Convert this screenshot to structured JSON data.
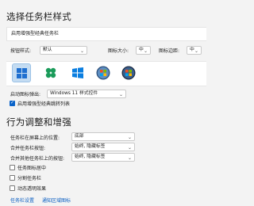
{
  "section1": {
    "title": "选择任务栏样式",
    "enable_classic_label": "启用增强型经典任务栏",
    "button_style_label": "按钮样式:",
    "button_style_value": "默认",
    "icon_size_label": "图标大小:",
    "icon_size_value": "中",
    "icon_margin_label": "图标边距:",
    "icon_margin_value": "中",
    "start_button_label": "启动图标弹出:",
    "start_button_value": "Windows 11 样式控件",
    "jumplist_label": "启用增强型经典跳转列表"
  },
  "taskbar_styles": [
    {
      "name": "win11-start",
      "selected": true
    },
    {
      "name": "clover-start",
      "selected": false
    },
    {
      "name": "win10-start",
      "selected": false
    },
    {
      "name": "win7-orb",
      "selected": false
    },
    {
      "name": "vista-orb",
      "selected": false
    }
  ],
  "section2": {
    "title": "行为调整和增强",
    "position_label": "任务栏在屏幕上的位置:",
    "position_value": "底部",
    "combine_label": "合并任务栏按钮:",
    "combine_value": "始终, 隐藏标签",
    "combine_other_label": "合并其他任务栏上的按钮:",
    "combine_other_value": "始终, 隐藏标签",
    "center_icons_label": "任务图标居中",
    "clock_label": "分割任务栏",
    "animation_label": "动态透明效果"
  },
  "links": {
    "taskbar_settings": "任务栏设置",
    "tray_settings": "通知区域图标"
  },
  "colors": {
    "accent": "#0a63c9",
    "selected_bg": "#c4dcf2"
  }
}
